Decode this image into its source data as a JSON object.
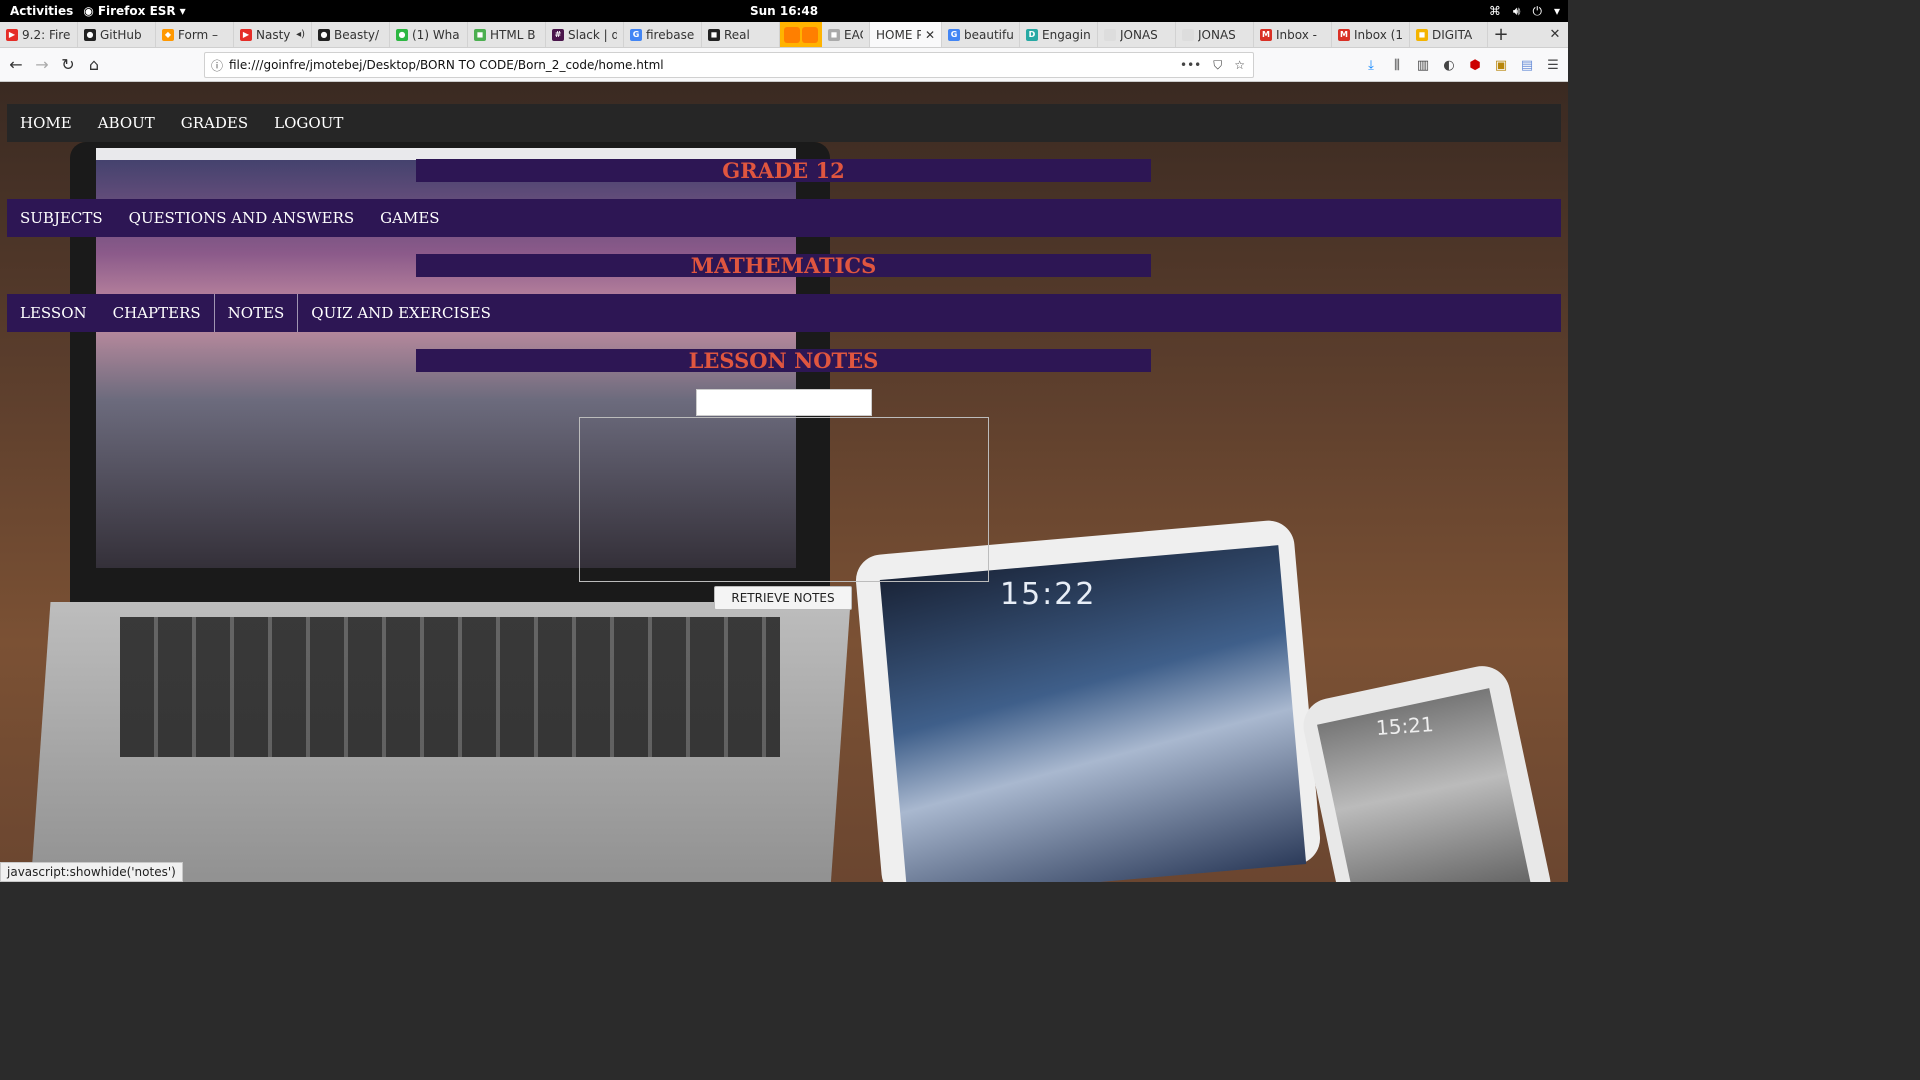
{
  "topbar": {
    "activities": "Activities",
    "app_name": "Firefox ESR",
    "clock": "Sun 16:48"
  },
  "tabs": [
    {
      "title": "9.2: Fire",
      "color": "#e52d27",
      "glyph": "▶"
    },
    {
      "title": "GitHub",
      "color": "#222222",
      "glyph": "●"
    },
    {
      "title": "Form –",
      "color": "#ff9800",
      "glyph": "◆"
    },
    {
      "title": "Nasty",
      "color": "#e52d27",
      "glyph": "▶"
    },
    {
      "title": "Beasty/",
      "color": "#222222",
      "glyph": "●"
    },
    {
      "title": "(1) Wha",
      "color": "#2db742",
      "glyph": "●"
    },
    {
      "title": "HTML B",
      "color": "#4caf50",
      "glyph": "◼"
    },
    {
      "title": "Slack | d",
      "color": "#4a154b",
      "glyph": "#"
    },
    {
      "title": "firebase",
      "color": "#4285f4",
      "glyph": "G"
    },
    {
      "title": "Real",
      "color": "#222222",
      "glyph": "◼"
    }
  ],
  "tabs_after": [
    {
      "title": "EACH",
      "color": "#aaaaaa",
      "glyph": "◼"
    }
  ],
  "active_tab": {
    "title": "HOME P",
    "close": "✕"
  },
  "tabs_right": [
    {
      "title": "beautifu",
      "color": "#4285f4",
      "glyph": "G"
    },
    {
      "title": "Engagin",
      "color": "#27a9a4",
      "glyph": "D"
    },
    {
      "title": "JONAS",
      "color": "#dddddd",
      "glyph": ""
    },
    {
      "title": "JONAS",
      "color": "#dddddd",
      "glyph": ""
    },
    {
      "title": "Inbox -",
      "color": "#d93025",
      "glyph": "M"
    },
    {
      "title": "Inbox (1",
      "color": "#d93025",
      "glyph": "M"
    },
    {
      "title": "DIGITA",
      "color": "#f4b400",
      "glyph": "◼"
    }
  ],
  "url": "file:///goinfre/jmotebej/Desktop/BORN TO CODE/Born_2_code/home.html",
  "site": {
    "main_nav": [
      "HOME",
      "ABOUT",
      "GRADES",
      "LOGOUT"
    ],
    "grade_title": "GRADE 12",
    "grade_nav": [
      "SUBJECTS",
      "QUESTIONS AND ANSWERS",
      "GAMES"
    ],
    "subject_title": "MATHEMATICS",
    "subject_nav": [
      "LESSON",
      "CHAPTERS",
      "NOTES",
      "QUIZ AND EXERCISES"
    ],
    "notes_title": "LESSON NOTES",
    "notes_input_value": "",
    "notes_textarea_value": "",
    "retrieve_label": "RETRIEVE NOTES"
  },
  "background_photo": {
    "ipad_time": "15:22",
    "phone_time": "15:21"
  },
  "statusbar": "javascript:showhide('notes')",
  "colors": {
    "nav_dark": "#262626",
    "purple": "#2d1654",
    "title_red": "#e0563f"
  }
}
